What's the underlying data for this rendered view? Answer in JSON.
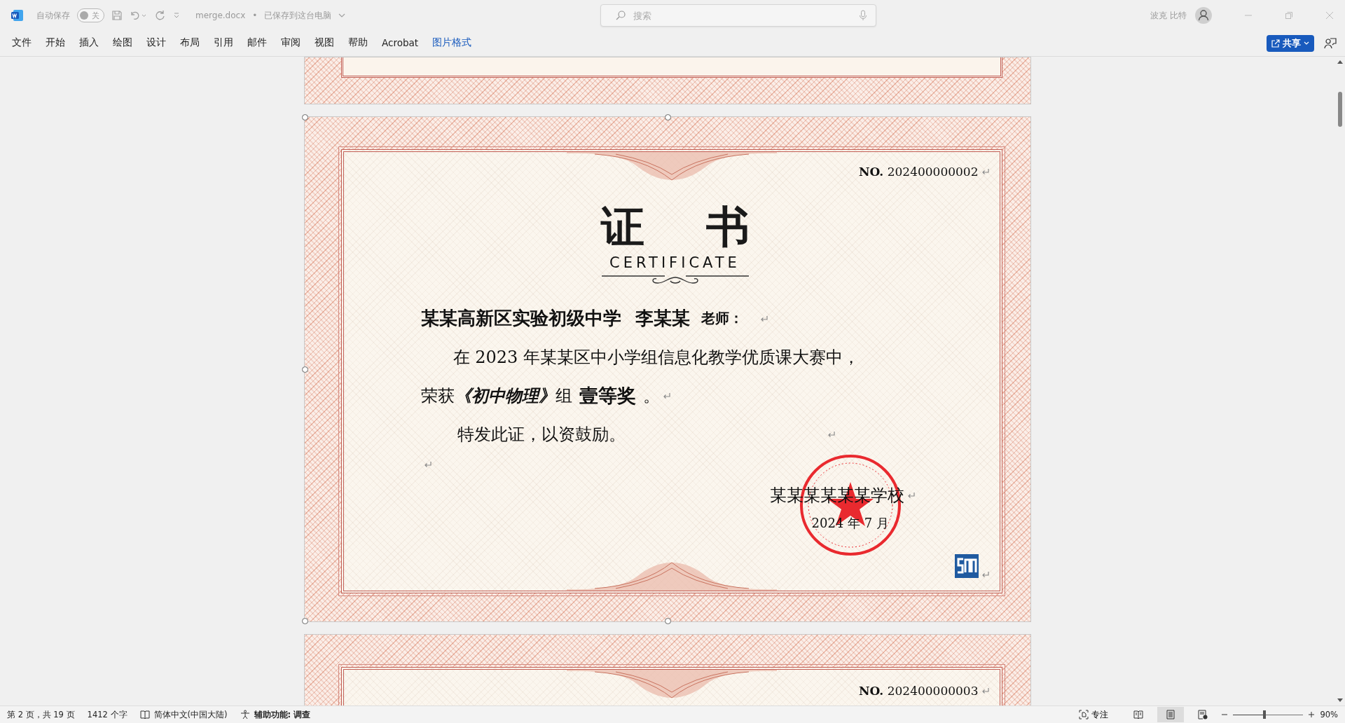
{
  "title_bar": {
    "autosave_label": "自动保存",
    "autosave": {
      "on": false,
      "label": "关"
    },
    "file_name": "merge.docx",
    "separator": "•",
    "save_status": "已保存到这台电脑",
    "search": {
      "placeholder": "搜索"
    },
    "user_name": "波克 比特"
  },
  "menu": {
    "tabs": [
      {
        "label": "文件",
        "kind": "normal",
        "selected": false
      },
      {
        "label": "开始",
        "kind": "normal",
        "selected": false
      },
      {
        "label": "插入",
        "kind": "normal",
        "selected": false
      },
      {
        "label": "绘图",
        "kind": "normal",
        "selected": false
      },
      {
        "label": "设计",
        "kind": "normal",
        "selected": false
      },
      {
        "label": "布局",
        "kind": "normal",
        "selected": false
      },
      {
        "label": "引用",
        "kind": "normal",
        "selected": false
      },
      {
        "label": "邮件",
        "kind": "normal",
        "selected": false
      },
      {
        "label": "审阅",
        "kind": "normal",
        "selected": false
      },
      {
        "label": "视图",
        "kind": "normal",
        "selected": false
      },
      {
        "label": "帮助",
        "kind": "normal",
        "selected": false
      },
      {
        "label": "Acrobat",
        "kind": "normal",
        "selected": false
      },
      {
        "label": "图片格式",
        "kind": "contextual",
        "selected": false
      }
    ],
    "share_button": "共享"
  },
  "document": {
    "certificate": {
      "serial": "**NO.** 202400000002",
      "title_chars": [
        "证",
        "书"
      ],
      "subtitle": "CERTIFICATE",
      "school": "某某高新区实验初级中学",
      "teacher": "李某某",
      "honorific": "老师：",
      "body": "在 2023 年某某区中小学组信息化教学优质课大赛中，",
      "award_prefix": "荣获",
      "course": "《初中物理》",
      "group": "组",
      "award": "壹等奖",
      "award_end": "。",
      "closing": "特发此证，以资鼓励。",
      "issuer": "某某某某某某学校",
      "date": "2024 年 7 月"
    },
    "next_certificate": {
      "serial": "**NO.** 202400000003"
    }
  },
  "status_bar": {
    "page": "第 2 页，共 19 页",
    "word_count": "1412 个字",
    "language": "简体中文(中国大陆)",
    "accessibility": "辅助功能: 调查",
    "focus": "专注",
    "views": [
      {
        "kind": "read",
        "selected": false
      },
      {
        "kind": "print",
        "selected": true
      },
      {
        "kind": "web",
        "selected": false
      }
    ],
    "zoom": {
      "level": 0.45,
      "reading": "90%"
    }
  }
}
